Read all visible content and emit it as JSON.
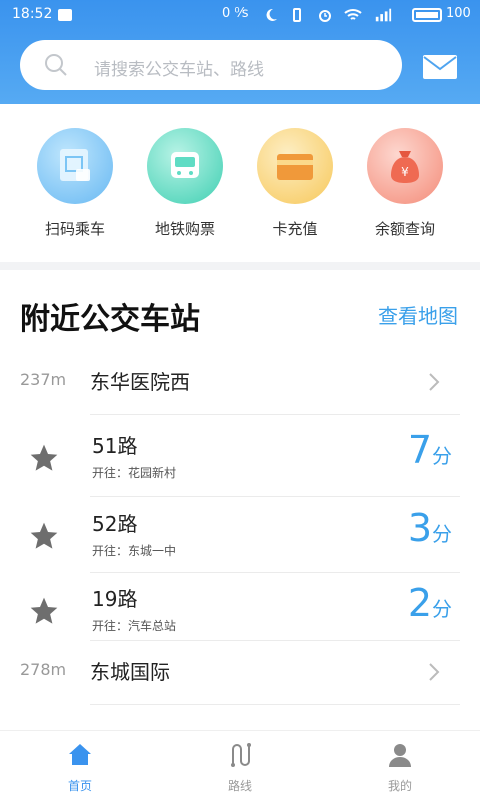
{
  "status_bar": {
    "time": "18:52",
    "network": "0 ⁰⁄s",
    "battery": "100"
  },
  "search": {
    "placeholder": "请搜索公交车站、路线"
  },
  "quick_actions": [
    {
      "label": "扫码乘车",
      "icon": "qr-scan-icon",
      "color": "#7cc5f5"
    },
    {
      "label": "地铁购票",
      "icon": "metro-ticket-icon",
      "color": "#5fdcc4"
    },
    {
      "label": "卡充值",
      "icon": "card-recharge-icon",
      "color": "#f7d27a"
    },
    {
      "label": "余额查询",
      "icon": "balance-query-icon",
      "color": "#f7a293"
    }
  ],
  "nearby": {
    "title": "附近公交车站",
    "map_link": "查看地图",
    "stations": [
      {
        "distance": "237m",
        "name": "东华医院西",
        "buses": [
          {
            "line": "51路",
            "direction": "开往：花园新村",
            "eta": "7",
            "unit": "分"
          },
          {
            "line": "52路",
            "direction": "开往：东城一中",
            "eta": "3",
            "unit": "分"
          },
          {
            "line": "19路",
            "direction": "开往：汽车总站",
            "eta": "2",
            "unit": "分"
          }
        ]
      },
      {
        "distance": "278m",
        "name": "东城国际",
        "buses": []
      }
    ]
  },
  "tabbar": {
    "tabs": [
      {
        "label": "首页",
        "icon": "home-icon",
        "active": true
      },
      {
        "label": "路线",
        "icon": "route-icon",
        "active": false
      },
      {
        "label": "我的",
        "icon": "profile-icon",
        "active": false
      }
    ]
  },
  "colors": {
    "accent": "#3a93ee",
    "eta": "#3aa0ea"
  }
}
